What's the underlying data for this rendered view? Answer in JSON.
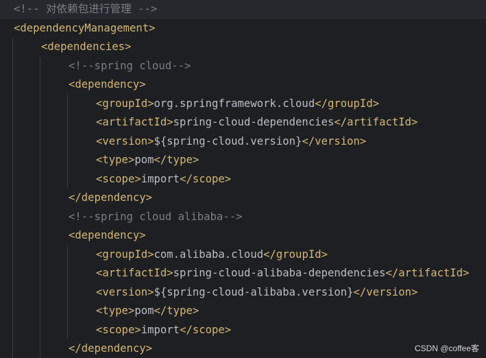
{
  "editor": {
    "lines": [
      {
        "indent": 0,
        "parts": [
          {
            "k": "comment",
            "t": "<!-- 对依赖包进行管理 -->"
          }
        ],
        "current": true
      },
      {
        "indent": 0,
        "parts": [
          {
            "k": "tag",
            "t": "<dependencyManagement>"
          }
        ]
      },
      {
        "indent": 1,
        "parts": [
          {
            "k": "tag",
            "t": "<dependencies>"
          }
        ]
      },
      {
        "indent": 2,
        "parts": [
          {
            "k": "comment",
            "t": "<!--spring cloud-->"
          }
        ]
      },
      {
        "indent": 2,
        "parts": [
          {
            "k": "tag",
            "t": "<dependency>"
          }
        ]
      },
      {
        "indent": 3,
        "parts": [
          {
            "k": "tag",
            "t": "<groupId>"
          },
          {
            "k": "text",
            "t": "org.springframework.cloud"
          },
          {
            "k": "tag",
            "t": "</groupId>"
          }
        ]
      },
      {
        "indent": 3,
        "parts": [
          {
            "k": "tag",
            "t": "<artifactId>"
          },
          {
            "k": "text",
            "t": "spring-cloud-dependencies"
          },
          {
            "k": "tag",
            "t": "</artifactId>"
          }
        ]
      },
      {
        "indent": 3,
        "parts": [
          {
            "k": "tag",
            "t": "<version>"
          },
          {
            "k": "text",
            "t": "${spring-cloud.version}"
          },
          {
            "k": "tag",
            "t": "</version>"
          }
        ]
      },
      {
        "indent": 3,
        "parts": [
          {
            "k": "tag",
            "t": "<type>"
          },
          {
            "k": "text",
            "t": "pom"
          },
          {
            "k": "tag",
            "t": "</type>"
          }
        ]
      },
      {
        "indent": 3,
        "parts": [
          {
            "k": "tag",
            "t": "<scope>"
          },
          {
            "k": "text",
            "t": "import"
          },
          {
            "k": "tag",
            "t": "</scope>"
          }
        ]
      },
      {
        "indent": 2,
        "parts": [
          {
            "k": "tag",
            "t": "</dependency>"
          }
        ]
      },
      {
        "indent": 2,
        "parts": [
          {
            "k": "comment",
            "t": "<!--spring cloud alibaba-->"
          }
        ]
      },
      {
        "indent": 2,
        "parts": [
          {
            "k": "tag",
            "t": "<dependency>"
          }
        ]
      },
      {
        "indent": 3,
        "parts": [
          {
            "k": "tag",
            "t": "<groupId>"
          },
          {
            "k": "text",
            "t": "com.alibaba.cloud"
          },
          {
            "k": "tag",
            "t": "</groupId>"
          }
        ]
      },
      {
        "indent": 3,
        "parts": [
          {
            "k": "tag",
            "t": "<artifactId>"
          },
          {
            "k": "text",
            "t": "spring-cloud-alibaba-dependencies"
          },
          {
            "k": "tag",
            "t": "</artifactId>"
          }
        ]
      },
      {
        "indent": 3,
        "parts": [
          {
            "k": "tag",
            "t": "<version>"
          },
          {
            "k": "text",
            "t": "${spring-cloud-alibaba.version}"
          },
          {
            "k": "tag",
            "t": "</version>"
          }
        ]
      },
      {
        "indent": 3,
        "parts": [
          {
            "k": "tag",
            "t": "<type>"
          },
          {
            "k": "text",
            "t": "pom"
          },
          {
            "k": "tag",
            "t": "</type>"
          }
        ]
      },
      {
        "indent": 3,
        "parts": [
          {
            "k": "tag",
            "t": "<scope>"
          },
          {
            "k": "text",
            "t": "import"
          },
          {
            "k": "tag",
            "t": "</scope>"
          }
        ]
      },
      {
        "indent": 2,
        "parts": [
          {
            "k": "tag",
            "t": "</dependency>"
          }
        ]
      }
    ]
  },
  "watermark": {
    "text": "CSDN @coffee客"
  },
  "colors": {
    "background": "#1e1f22",
    "current_line": "#26282e",
    "tag": "#d5b778",
    "text": "#bcbec4",
    "comment": "#7a7e85",
    "indent_guide": "#393b40"
  }
}
